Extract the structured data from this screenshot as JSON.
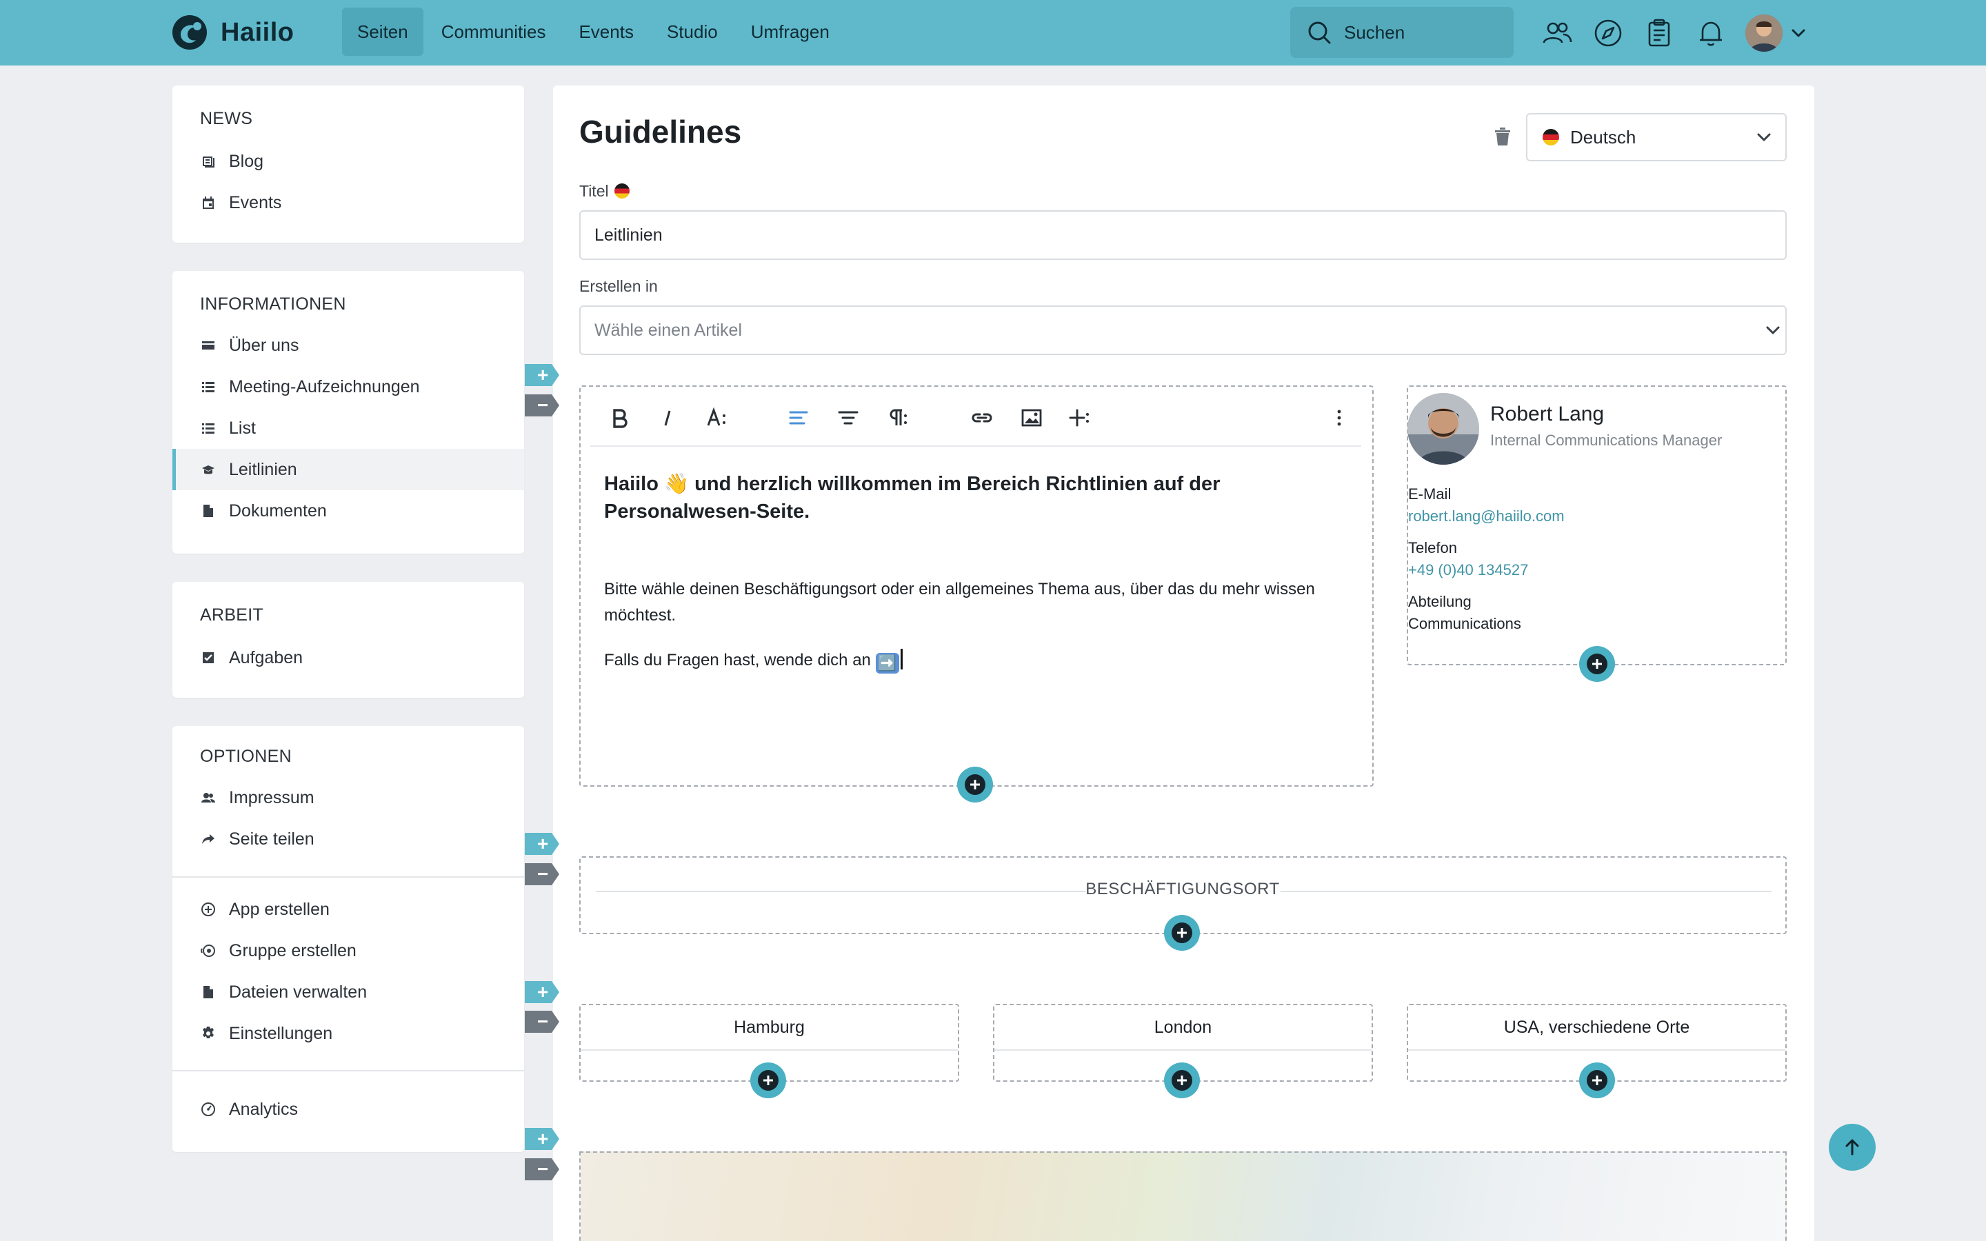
{
  "app": {
    "logo_text": "Haiilo"
  },
  "nav": {
    "items": [
      "Seiten",
      "Communities",
      "Events",
      "Studio",
      "Umfragen"
    ],
    "active": "Seiten"
  },
  "search": {
    "placeholder": "Suchen"
  },
  "icons": {
    "top": [
      "people-icon",
      "compass-icon",
      "clipboard-icon",
      "bell-icon",
      "avatar",
      "chevron-down-icon"
    ]
  },
  "sidebar": {
    "news": {
      "title": "NEWS",
      "items": [
        {
          "label": "Blog",
          "icon": "blog-icon"
        },
        {
          "label": "Events",
          "icon": "calendar-icon"
        }
      ]
    },
    "info": {
      "title": "INFORMATIONEN",
      "items": [
        {
          "label": "Über uns",
          "icon": "card-icon"
        },
        {
          "label": "Meeting-Aufzeichnungen",
          "icon": "list-icon"
        },
        {
          "label": "List",
          "icon": "list-icon"
        },
        {
          "label": "Leitlinien",
          "icon": "book-icon",
          "active": true
        },
        {
          "label": "Dokumenten",
          "icon": "file-icon"
        }
      ]
    },
    "work": {
      "title": "ARBEIT",
      "items": [
        {
          "label": "Aufgaben",
          "icon": "checkbox-icon"
        }
      ]
    },
    "options": {
      "title": "OPTIONEN",
      "items": [
        {
          "label": "Impressum",
          "icon": "people-icon"
        },
        {
          "label": "Seite teilen",
          "icon": "share-icon"
        },
        {
          "label": "App erstellen",
          "icon": "plus-circle-icon"
        },
        {
          "label": "Gruppe erstellen",
          "icon": "group-icon"
        },
        {
          "label": "Dateien verwalten",
          "icon": "file-icon"
        },
        {
          "label": "Einstellungen",
          "icon": "gear-icon"
        },
        {
          "label": "Analytics",
          "icon": "gauge-icon"
        }
      ]
    }
  },
  "page": {
    "title": "Guidelines",
    "language": "Deutsch",
    "title_label": "Titel",
    "title_value": "Leitlinien",
    "create_in_label": "Erstellen in",
    "create_in_placeholder": "Wähle einen Artikel"
  },
  "editor": {
    "heading": "Haiilo 👋 und herzlich willkommen im Bereich Richtlinien auf der Personalwesen-Seite.",
    "para1": "Bitte wähle deinen Beschäftigungsort oder ein allgemeines Thema aus, über das du mehr wissen möchtest.",
    "para2": "Falls du Fragen hast, wende dich an",
    "para2_emoji": "➡️"
  },
  "contact": {
    "name": "Robert Lang",
    "role": "Internal Communications Manager",
    "email_label": "E-Mail",
    "email": "robert.lang@haiilo.com",
    "phone_label": "Telefon",
    "phone": "+49 (0)40 134527",
    "dept_label": "Abteilung",
    "dept": "Communications"
  },
  "sections": {
    "employment_label": "BESCHÄFTIGUNGSORT",
    "locations": [
      "Hamburg",
      "London",
      "USA, verschiedene Orte"
    ]
  },
  "colors": {
    "topbar": "#5fb9cb",
    "accent": "#4ab0c3",
    "dark_tab": "#6f7880"
  }
}
